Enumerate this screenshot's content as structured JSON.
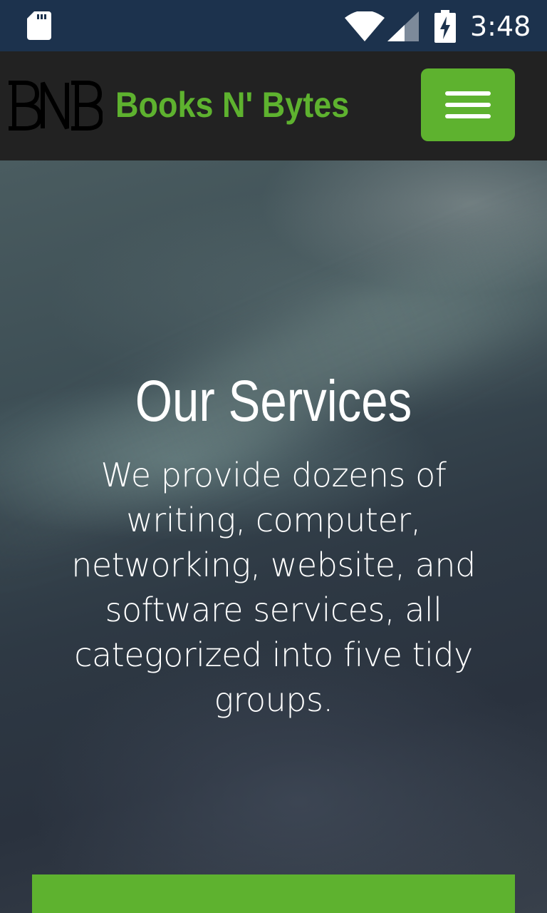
{
  "status_bar": {
    "time": "3:48",
    "icons": [
      "sd-card-icon",
      "wifi-icon",
      "cell-signal-icon",
      "battery-charging-icon"
    ]
  },
  "navbar": {
    "logo_icon": "bnb-logo-icon",
    "brand_name": "Books N' Bytes",
    "menu_icon": "hamburger-menu-icon"
  },
  "hero": {
    "title": "Our Services",
    "description": "We provide dozens of writing, computer, networking, website, and software services, all categorized into five tidy groups."
  },
  "colors": {
    "status_bar": "#1c324d",
    "navbar": "#222222",
    "accent": "#5eb22f",
    "text": "#ffffff"
  }
}
